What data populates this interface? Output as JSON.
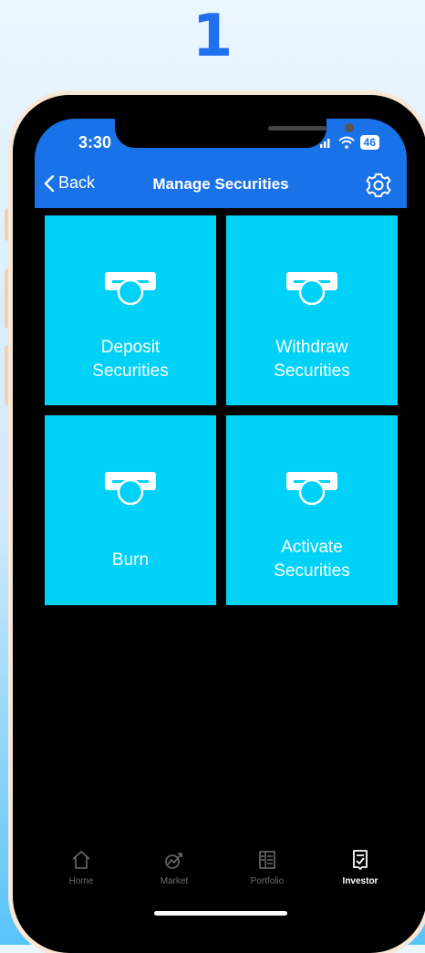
{
  "step": {
    "number": "1"
  },
  "status_bar": {
    "time": "3:30",
    "battery": "46"
  },
  "nav": {
    "back_label": "Back",
    "title": "Manage Securities"
  },
  "tiles": [
    {
      "label": "Deposit\nSecurities"
    },
    {
      "label": "Withdraw\nSecurities"
    },
    {
      "label": "Burn"
    },
    {
      "label": "Activate\nSecurities"
    }
  ],
  "tabbar": {
    "items": [
      {
        "label": "Home",
        "icon": "home-icon"
      },
      {
        "label": "Market",
        "icon": "market-icon"
      },
      {
        "label": "Portfolio",
        "icon": "portfolio-icon"
      },
      {
        "label": "Investor",
        "icon": "investor-icon",
        "active": true
      }
    ]
  },
  "colors": {
    "accent": "#1a72e8",
    "tile": "#00d2f7",
    "step_number": "#1f6ff0"
  }
}
